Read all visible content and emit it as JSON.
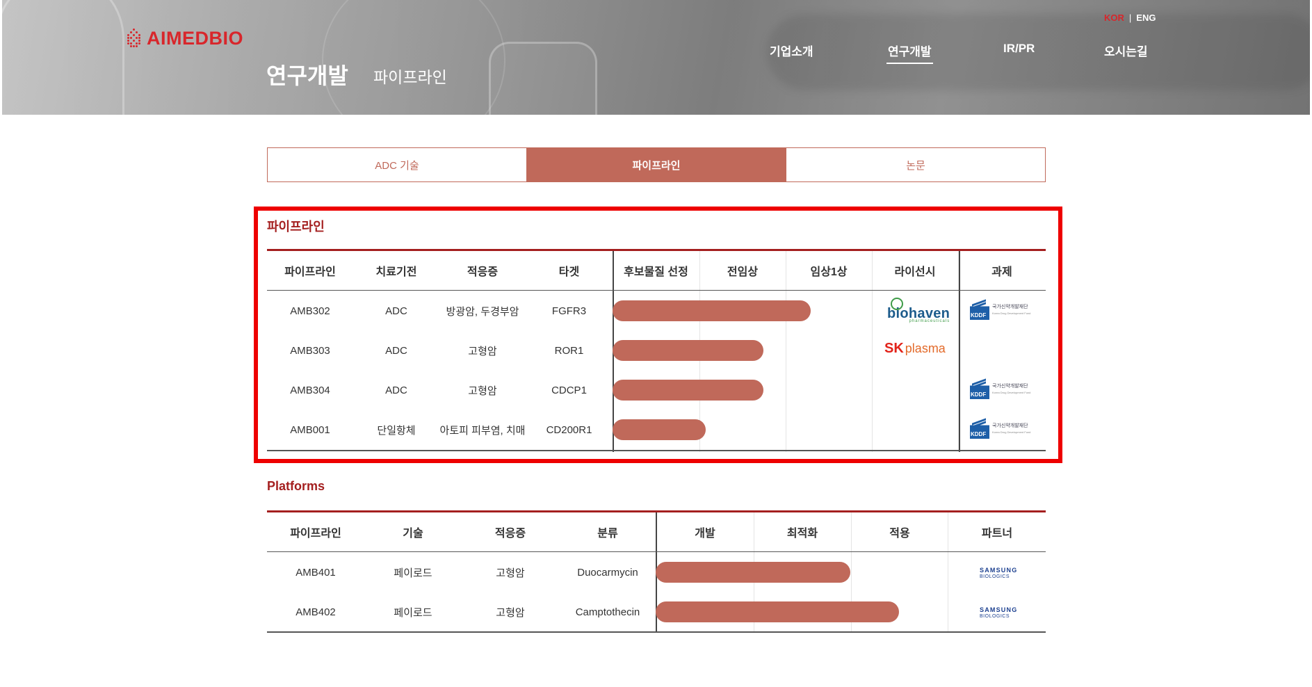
{
  "header": {
    "logo_text": "AIMEDBIO",
    "page_title": "연구개발",
    "page_subtitle": "파이프라인",
    "lang": {
      "kor": "KOR",
      "eng": "ENG",
      "sep": "|"
    },
    "nav": [
      "기업소개",
      "연구개발",
      "IR/PR",
      "오시는길"
    ],
    "nav_active": "연구개발"
  },
  "tabs": [
    {
      "label": "ADC 기술",
      "active": false
    },
    {
      "label": "파이프라인",
      "active": true
    },
    {
      "label": "논문",
      "active": false
    }
  ],
  "pipeline": {
    "title": "파이프라인",
    "headers": [
      "파이프라인",
      "치료기전",
      "적응증",
      "타겟",
      "후보물질 선정",
      "전임상",
      "임상1상",
      "라이선시",
      "과제"
    ],
    "rows": [
      {
        "name": "AMB302",
        "mechanism": "ADC",
        "indication": "방광암, 두경부암",
        "target": "FGFR3",
        "progress_stages": 2.3,
        "licensee": "biohaven",
        "project": "KDDF"
      },
      {
        "name": "AMB303",
        "mechanism": "ADC",
        "indication": "고형암",
        "target": "ROR1",
        "progress_stages": 1.75,
        "licensee": "SK plasma",
        "project": ""
      },
      {
        "name": "AMB304",
        "mechanism": "ADC",
        "indication": "고형암",
        "target": "CDCP1",
        "progress_stages": 1.75,
        "licensee": "",
        "project": "KDDF"
      },
      {
        "name": "AMB001",
        "mechanism": "단일항체",
        "indication": "아토피 피부염, 치매",
        "target": "CD200R1",
        "progress_stages": 1.08,
        "licensee": "",
        "project": "KDDF"
      }
    ]
  },
  "platforms": {
    "title": "Platforms",
    "headers": [
      "파이프라인",
      "기술",
      "적응증",
      "분류",
      "개발",
      "최적화",
      "적용",
      "파트너"
    ],
    "rows": [
      {
        "name": "AMB401",
        "tech": "페이로드",
        "indication": "고형암",
        "category": "Duocarmycin",
        "progress_stages": 2.0,
        "partner": "SAMSUNG BIOLOGICS"
      },
      {
        "name": "AMB402",
        "tech": "페이로드",
        "indication": "고형암",
        "category": "Camptothecin",
        "progress_stages": 2.5,
        "partner": "SAMSUNG BIOLOGICS"
      }
    ]
  },
  "logos": {
    "biohaven_word": "biohaven",
    "biohaven_sub": "pharmaceuticals",
    "sk": "SK",
    "plasma": "plasma",
    "kddf_mark": "KDDF",
    "kddf_name": "국가신약개발재단",
    "kddf_en": "Korea Drug Development Fund",
    "samsung_1": "SAMSUNG",
    "samsung_2": "BIOLOGICS"
  },
  "colors": {
    "accent": "#c0695a",
    "brand_red": "#d8262b",
    "title_red": "#a41f1f",
    "highlight": "#ee0000"
  }
}
